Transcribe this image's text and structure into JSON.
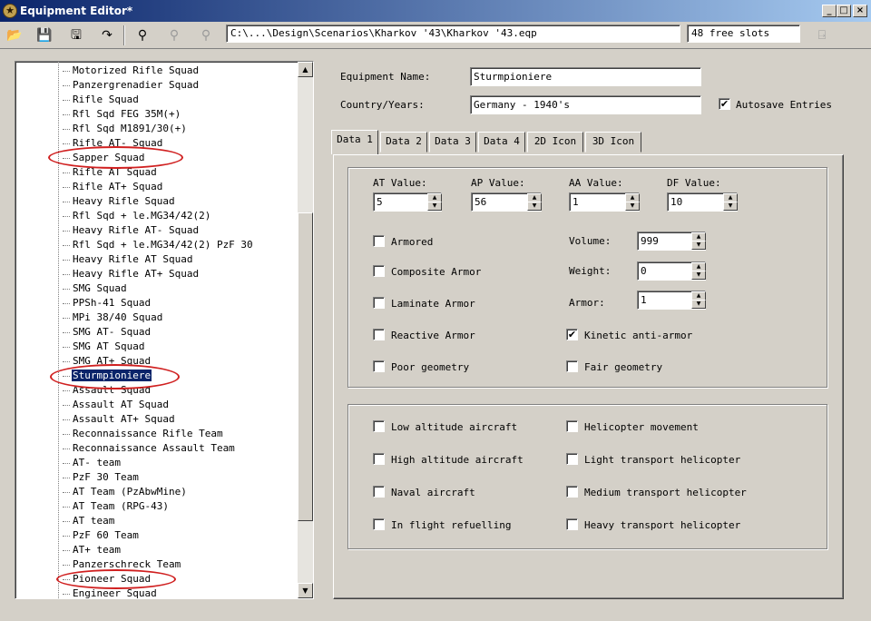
{
  "window": {
    "title": "Equipment Editor*"
  },
  "toolbar": {
    "path": "C:\\...\\Design\\Scenarios\\Kharkov '43\\Kharkov '43.eqp",
    "free_slots": "48 free slots"
  },
  "tree": {
    "items": [
      "Motorized Rifle Squad",
      "Panzergrenadier Squad",
      "Rifle Squad",
      "Rfl Sqd FEG 35M(+)",
      "Rfl Sqd M1891/30(+)",
      "Rifle AT- Squad",
      "Sapper Squad",
      "Rifle AT Squad",
      "Rifle AT+ Squad",
      "Heavy Rifle Squad",
      "Rfl Sqd + le.MG34/42(2)",
      "Heavy Rifle AT- Squad",
      "Rfl Sqd + le.MG34/42(2) PzF 30",
      "Heavy Rifle AT Squad",
      "Heavy Rifle AT+ Squad",
      "SMG Squad",
      "PPSh-41 Squad",
      "MPi 38/40 Squad",
      "SMG AT- Squad",
      "SMG AT Squad",
      "SMG AT+ Squad",
      "Sturmpioniere",
      "Assault Squad",
      "Assault AT Squad",
      "Assault AT+ Squad",
      "Reconnaissance Rifle Team",
      "Reconnaissance Assault Team",
      "AT- team",
      "PzF 30 Team",
      "AT Team (PzAbwMine)",
      "AT Team (RPG-43)",
      "AT team",
      "PzF 60 Team",
      "AT+ team",
      "Panzerschreck Team",
      "Pioneer Squad",
      "Engineer Squad"
    ],
    "selected_index": 21
  },
  "form": {
    "equipment_name_label": "Equipment Name:",
    "equipment_name": "Sturmpioniere",
    "country_label": "Country/Years:",
    "country": "Germany - 1940's",
    "autosave_label": "Autosave Entries",
    "autosave_checked": true
  },
  "tabs": [
    "Data 1",
    "Data 2",
    "Data 3",
    "Data 4",
    "2D Icon",
    "3D Icon"
  ],
  "data1": {
    "at_label": "AT Value:",
    "at_value": "5",
    "ap_label": "AP Value:",
    "ap_value": "56",
    "aa_label": "AA Value:",
    "aa_value": "1",
    "df_label": "DF Value:",
    "df_value": "10",
    "volume_label": "Volume:",
    "volume_value": "999",
    "weight_label": "Weight:",
    "weight_value": "0",
    "armor_label": "Armor:",
    "armor_value": "1",
    "armored": "Armored",
    "composite": "Composite Armor",
    "laminate": "Laminate Armor",
    "reactive": "Reactive Armor",
    "poor_geometry": "Poor geometry",
    "kinetic": "Kinetic anti-armor",
    "kinetic_checked": true,
    "fair_geometry": "Fair geometry",
    "low_alt": "Low altitude aircraft",
    "high_alt": "High altitude aircraft",
    "naval": "Naval aircraft",
    "refuel": "In flight refuelling",
    "heli_move": "Helicopter movement",
    "light_heli": "Light transport helicopter",
    "medium_heli": "Medium transport helicopter",
    "heavy_heli": "Heavy transport helicopter"
  },
  "colors": {
    "title_start": "#0a246a",
    "title_end": "#a6caf0",
    "selection": "#0a246a",
    "annotation": "#d02020",
    "face": "#d4d0c8"
  }
}
